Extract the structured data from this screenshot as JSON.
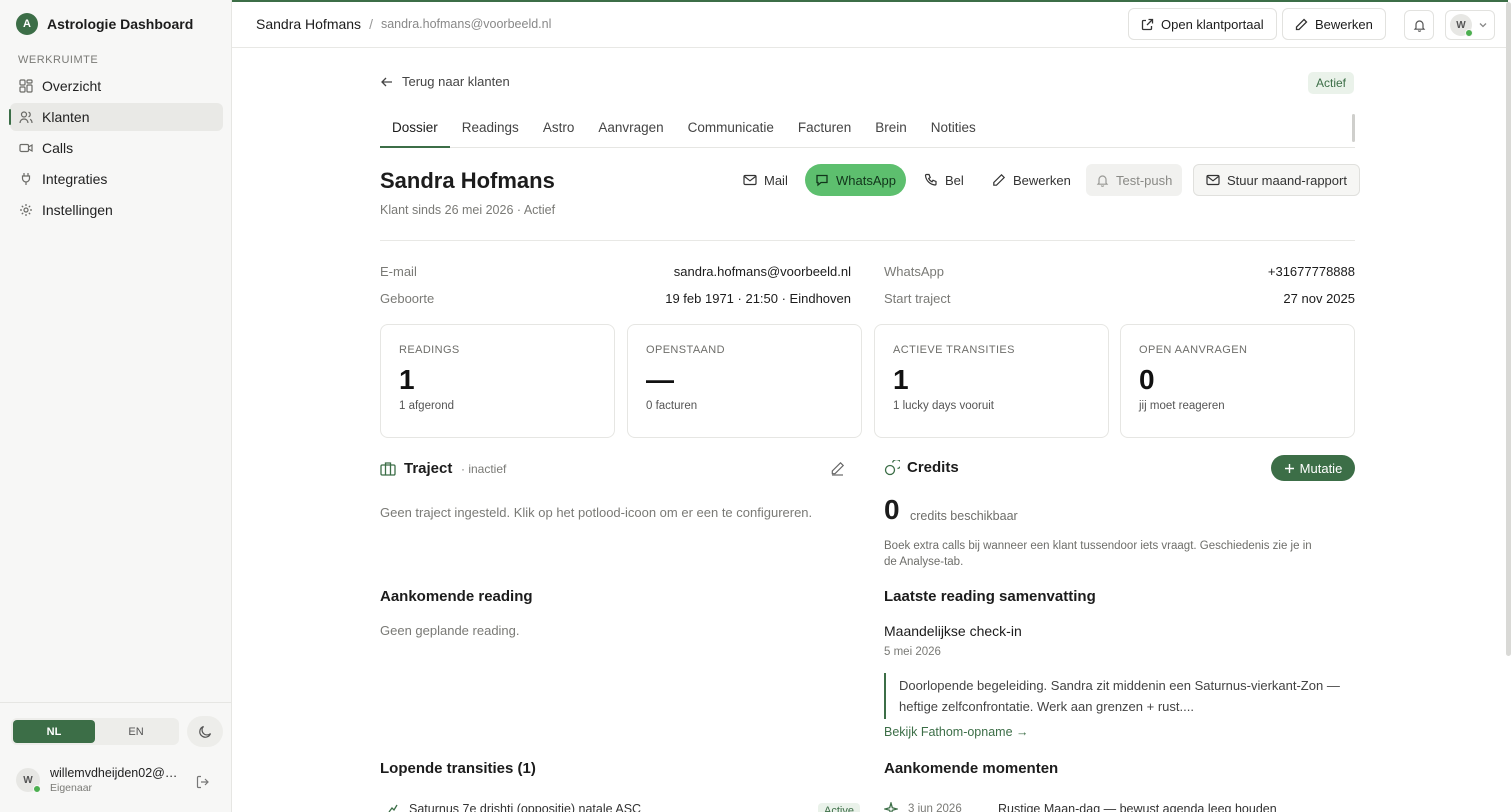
{
  "sidebar": {
    "brand_initial": "A",
    "brand_name": "Astrologie Dashboard",
    "section_label": "WERKRUIMTE",
    "items": [
      {
        "label": "Overzicht",
        "icon": "grid-icon"
      },
      {
        "label": "Klanten",
        "icon": "users-icon"
      },
      {
        "label": "Calls",
        "icon": "video-icon"
      },
      {
        "label": "Integraties",
        "icon": "plug-icon"
      },
      {
        "label": "Instellingen",
        "icon": "gear-icon"
      }
    ],
    "active_item": "Klanten",
    "lang": {
      "nl": "NL",
      "en": "EN",
      "selected": "NL"
    },
    "user": {
      "initial": "W",
      "email": "willemvdheijden02@g...",
      "role": "Eigenaar"
    }
  },
  "topbar": {
    "breadcrumb_name": "Sandra Hofmans",
    "breadcrumb_sep": "/",
    "breadcrumb_email": "sandra.hofmans@voorbeeld.nl",
    "open_portal": "Open klantportaal",
    "edit": "Bewerken",
    "avatar_initial": "W"
  },
  "main": {
    "back": "Terug naar klanten",
    "status": "Actief",
    "tabs": [
      "Dossier",
      "Readings",
      "Astro",
      "Aanvragen",
      "Communicatie",
      "Facturen",
      "Brein",
      "Notities"
    ],
    "active_tab": "Dossier",
    "client": {
      "name": "Sandra Hofmans",
      "since": "Klant sinds 26 mei 2026 · Actief"
    },
    "actions": {
      "mail": "Mail",
      "whatsapp": "WhatsApp",
      "call": "Bel",
      "edit": "Bewerken",
      "test_push": "Test-push",
      "report": "Stuur maand-rapport"
    },
    "details": {
      "email_label": "E-mail",
      "email": "sandra.hofmans@voorbeeld.nl",
      "birth_label": "Geboorte",
      "birth": "19 feb 1971 · 21:50 · Eindhoven",
      "whatsapp_label": "WhatsApp",
      "whatsapp": "+31677778888",
      "start_label": "Start traject",
      "start": "27 nov 2025"
    },
    "stats": [
      {
        "label": "READINGS",
        "value": "1",
        "sub": "1 afgerond"
      },
      {
        "label": "OPENSTAAND",
        "value": "—",
        "sub": "0 facturen"
      },
      {
        "label": "ACTIEVE TRANSITIES",
        "value": "1",
        "sub": "1 lucky days vooruit"
      },
      {
        "label": "OPEN AANVRAGEN",
        "value": "0",
        "sub": "jij moet reageren"
      }
    ],
    "traject": {
      "title": "Traject",
      "state": "· inactief",
      "empty": "Geen traject ingesteld. Klik op het potlood-icoon om er een te configureren."
    },
    "credits": {
      "title": "Credits",
      "mutation": "Mutatie",
      "count": "0",
      "unit": "credits beschikbaar",
      "note": "Boek extra calls bij wanneer een klant tussendoor iets vraagt. Geschiedenis zie je in de Analyse-tab."
    },
    "upcoming_reading": {
      "title": "Aankomende reading",
      "empty": "Geen geplande reading."
    },
    "last_reading": {
      "title": "Laatste reading samenvatting",
      "name": "Maandelijkse check-in",
      "date": "5 mei 2026",
      "summary": "Doorlopende begeleiding. Sandra zit middenin een Saturnus-vierkant-Zon — heftige zelfconfrontatie. Werk aan grenzen + rust....",
      "link": "Bekijk Fathom-opname →"
    },
    "transits": {
      "title": "Lopende transities (1)",
      "item": "Saturnus 7e drishti (oppositie) natale ASC",
      "badge": "Active"
    },
    "moments": {
      "title": "Aankomende momenten",
      "date": "3 jun 2026",
      "item": "Rustige Maan-dag — bewust agenda leeg houden"
    }
  },
  "colors": {
    "accent": "#3c6e47",
    "whatsapp": "#5dbf6e"
  }
}
